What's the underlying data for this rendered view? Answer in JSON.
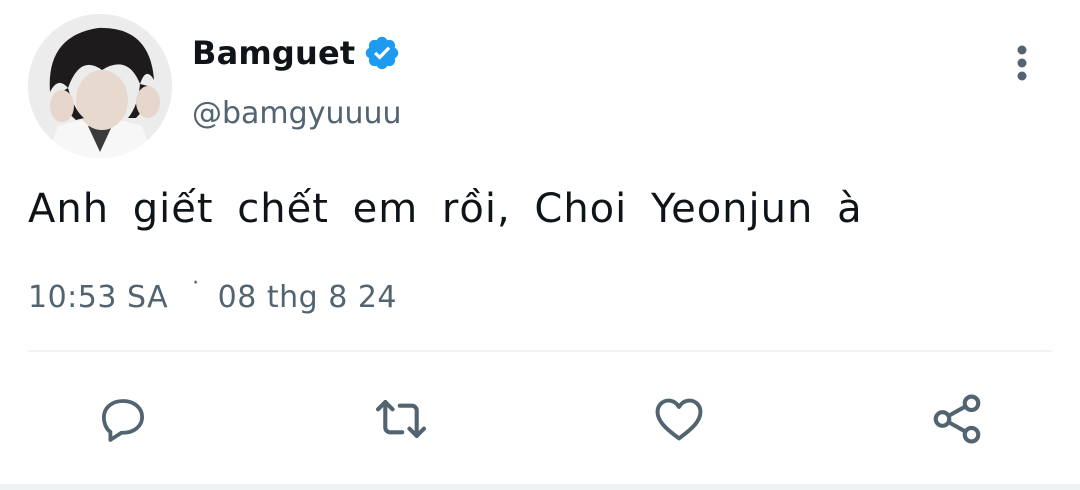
{
  "user": {
    "display_name": "Bamguet",
    "handle": "@bamgyuuuu",
    "verified": true,
    "avatar_icon": "profile-photo"
  },
  "tweet": {
    "text": "Anh giết chết em rồi, Choi Yeonjun à",
    "time": "10:53 SA",
    "separator": "·",
    "date": "08 thg 8 24"
  },
  "icons": {
    "more": "more-vertical-icon",
    "reply": "reply-icon",
    "retweet": "retweet-icon",
    "like": "heart-icon",
    "share": "share-icon"
  },
  "colors": {
    "text": "#0f1419",
    "secondary": "#536471",
    "verified": "#1d9bf0",
    "divider": "#eff3f4"
  }
}
